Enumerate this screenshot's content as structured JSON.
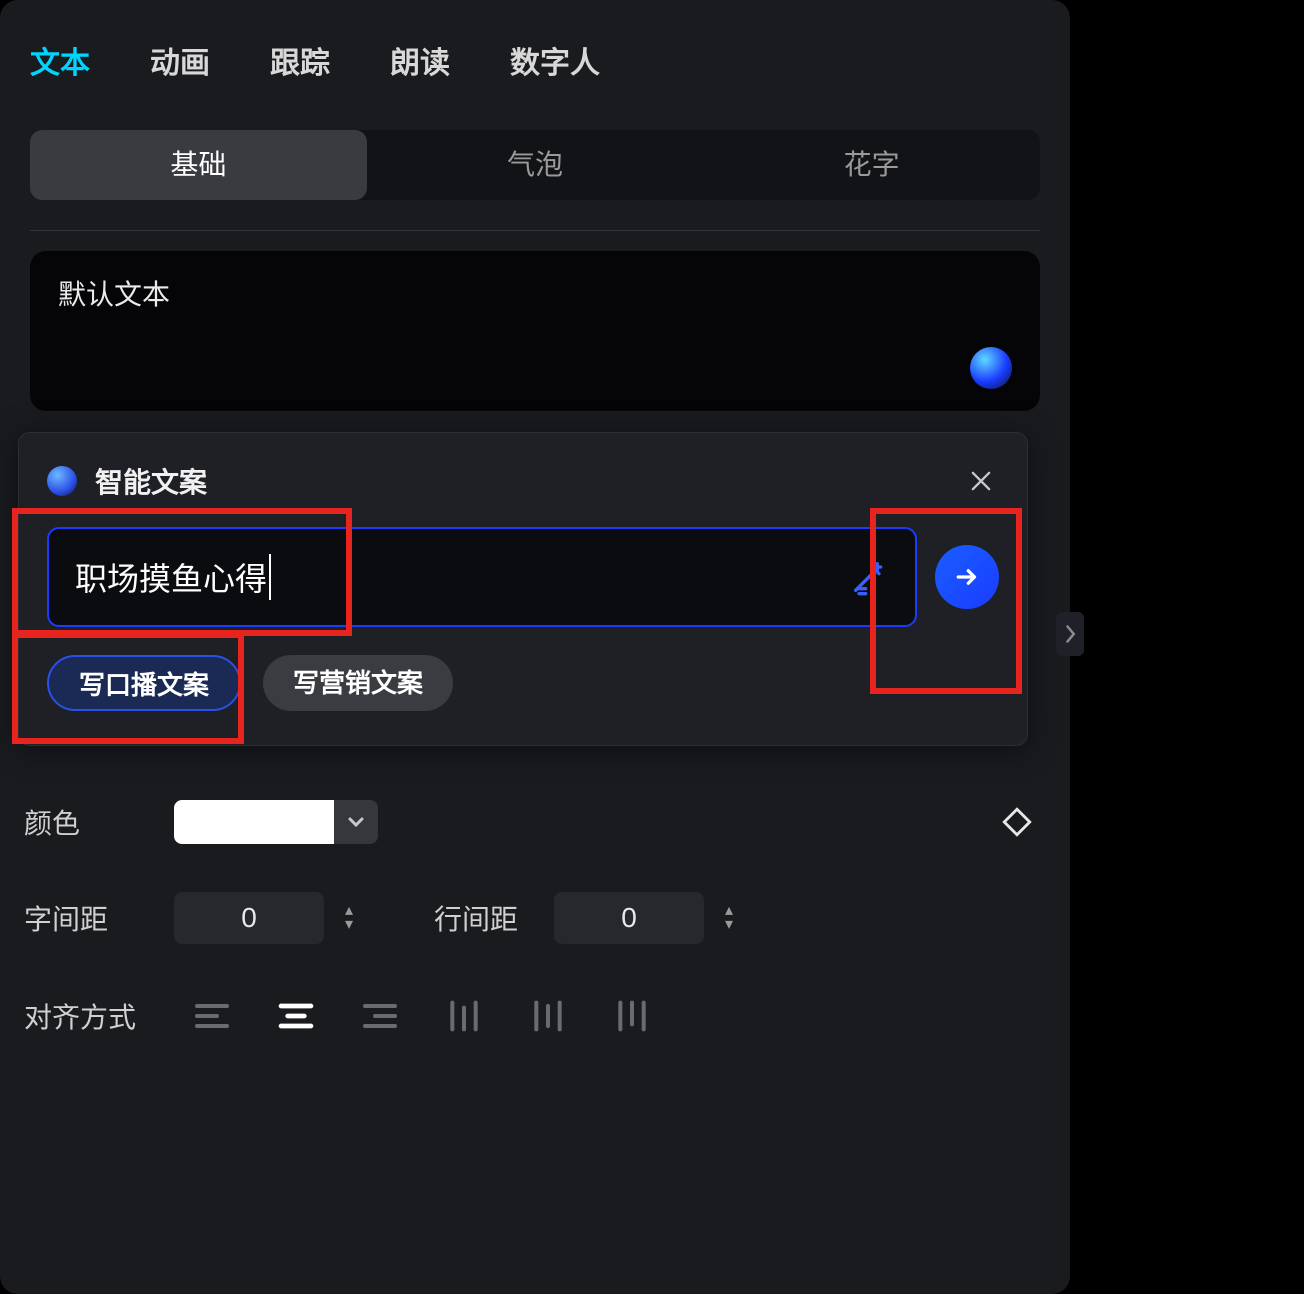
{
  "top_tabs": [
    "文本",
    "动画",
    "跟踪",
    "朗读",
    "数字人"
  ],
  "top_active_index": 0,
  "sub_tabs": [
    "基础",
    "气泡",
    "花字"
  ],
  "sub_active_index": 0,
  "text_area": {
    "value": "默认文本"
  },
  "popup": {
    "title": "智能文案",
    "input_value": "职场摸鱼心得",
    "chips": [
      "写口播文案",
      "写营销文案"
    ],
    "chip_active_index": 0
  },
  "color_row": {
    "label": "颜色",
    "value": "#FFFFFF"
  },
  "spacing": {
    "char_label": "字间距",
    "char_value": "0",
    "line_label": "行间距",
    "line_value": "0"
  },
  "alignment": {
    "label": "对齐方式",
    "active_index": 1
  }
}
